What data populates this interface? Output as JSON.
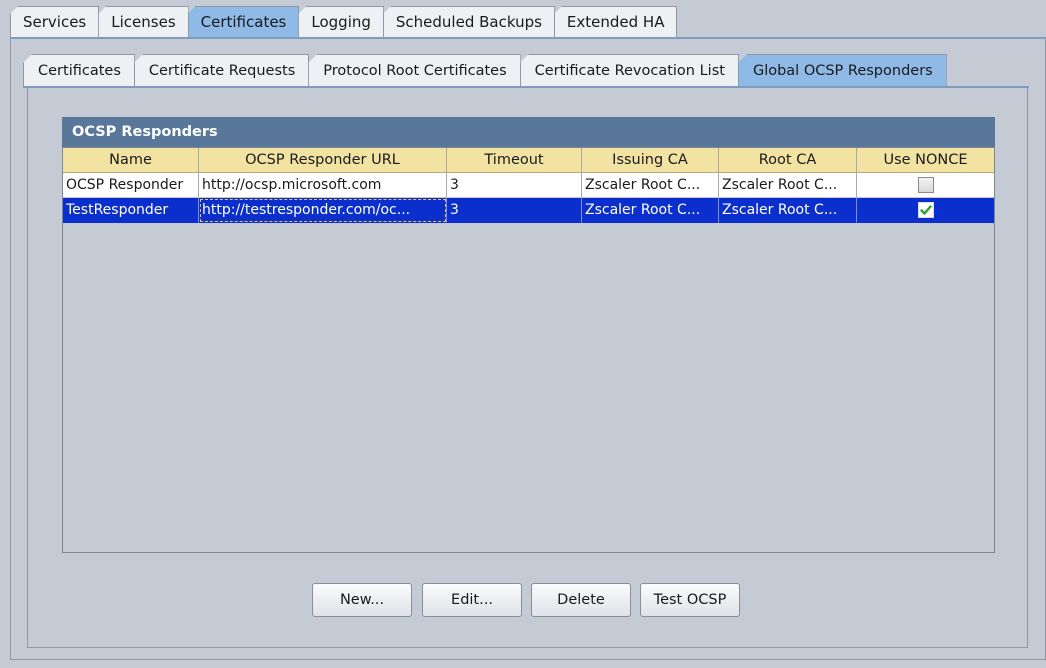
{
  "top_tabs": [
    {
      "label": "Services",
      "active": false
    },
    {
      "label": "Licenses",
      "active": false
    },
    {
      "label": "Certificates",
      "active": true
    },
    {
      "label": "Logging",
      "active": false
    },
    {
      "label": "Scheduled Backups",
      "active": false
    },
    {
      "label": "Extended HA",
      "active": false
    }
  ],
  "sub_tabs": [
    {
      "label": "Certificates",
      "active": false
    },
    {
      "label": "Certificate Requests",
      "active": false
    },
    {
      "label": "Protocol Root Certificates",
      "active": false
    },
    {
      "label": "Certificate Revocation List",
      "active": false
    },
    {
      "label": "Global OCSP Responders",
      "active": true
    }
  ],
  "group": {
    "title": "OCSP Responders"
  },
  "table": {
    "columns": [
      "Name",
      "OCSP Responder URL",
      "Timeout",
      "Issuing CA",
      "Root CA",
      "Use NONCE"
    ],
    "rows": [
      {
        "name": "OCSP Responder",
        "url": "http://ocsp.microsoft.com",
        "timeout": "3",
        "issuing_ca": "Zscaler Root C...",
        "root_ca": "Zscaler Root C...",
        "use_nonce": false,
        "selected": false
      },
      {
        "name": "TestResponder",
        "url": "http://testresponder.com/oc...",
        "timeout": "3",
        "issuing_ca": "Zscaler Root C...",
        "root_ca": "Zscaler Root C...",
        "use_nonce": true,
        "selected": true
      }
    ]
  },
  "buttons": {
    "new": "New...",
    "edit": "Edit...",
    "delete": "Delete",
    "test": "Test OCSP"
  },
  "colors": {
    "active_tab": "#8fb9e6",
    "group_header": "#58779b",
    "column_header": "#f2e3a3",
    "selection": "#0a2fcc",
    "check_mark": "#2e9e2e"
  }
}
